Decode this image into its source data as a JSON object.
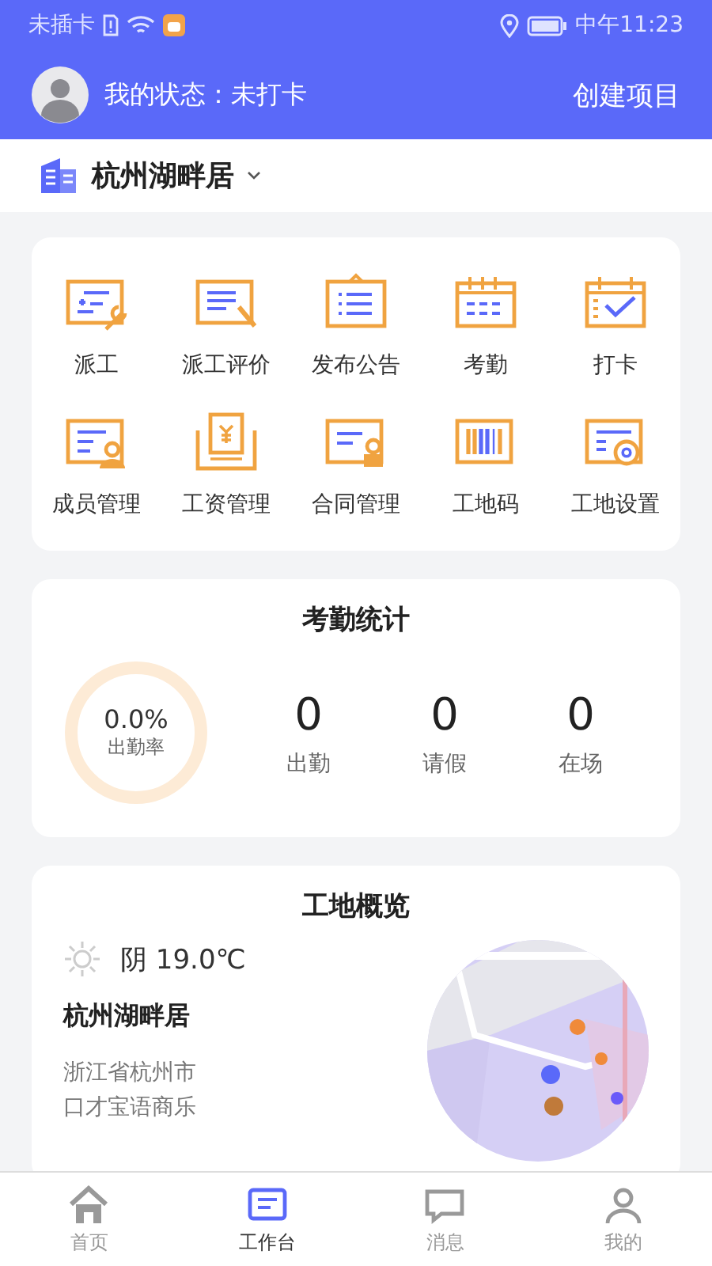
{
  "status_bar": {
    "carrier": "未插卡",
    "time": "中午11:23"
  },
  "header": {
    "status_text": "我的状态：未打卡",
    "action": "创建项目"
  },
  "site_selector": {
    "name": "杭州湖畔居"
  },
  "shortcuts": [
    {
      "label": "派工"
    },
    {
      "label": "派工评价"
    },
    {
      "label": "发布公告"
    },
    {
      "label": "考勤"
    },
    {
      "label": "打卡"
    },
    {
      "label": "成员管理"
    },
    {
      "label": "工资管理"
    },
    {
      "label": "合同管理"
    },
    {
      "label": "工地码"
    },
    {
      "label": "工地设置"
    }
  ],
  "attendance": {
    "title": "考勤统计",
    "rate": "0.0%",
    "rate_label": "出勤率",
    "level": 0,
    "stats": [
      {
        "value": "0",
        "label": "出勤"
      },
      {
        "value": "0",
        "label": "请假"
      },
      {
        "value": "0",
        "label": "在场"
      }
    ]
  },
  "overview": {
    "title": "工地概览",
    "weather": "阴 19.0℃",
    "site_name": "杭州湖畔居",
    "address_lines": [
      "浙江省杭州市",
      "口才宝语商乐"
    ]
  },
  "tab_bar": [
    {
      "label": "首页",
      "selected": false
    },
    {
      "label": "工作台",
      "selected": true
    },
    {
      "label": "消息",
      "selected": false
    },
    {
      "label": "我的",
      "selected": false
    }
  ]
}
